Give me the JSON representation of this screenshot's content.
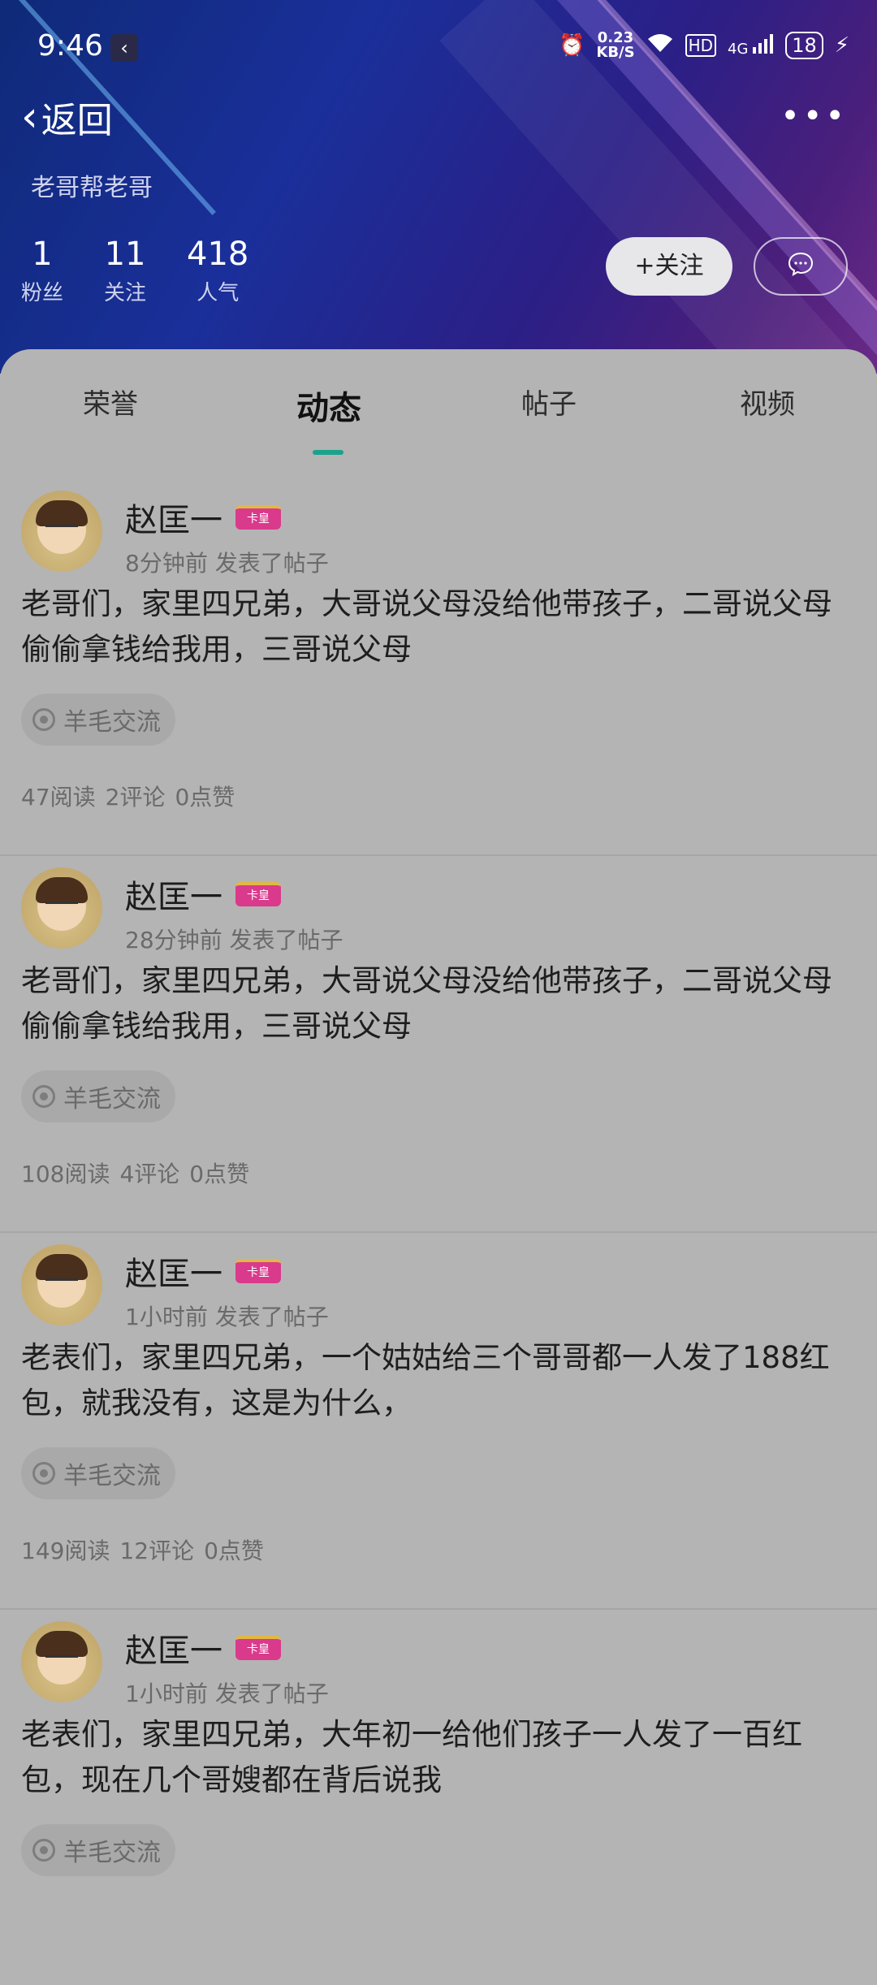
{
  "status_bar": {
    "time": "9:46",
    "speed_value": "0.23",
    "speed_unit": "KB/S",
    "hd": "HD",
    "network": "4G",
    "battery": "18"
  },
  "header": {
    "back_label": "返回",
    "nickname": "老哥帮老哥",
    "stats": [
      {
        "num": "1",
        "label": "粉丝"
      },
      {
        "num": "11",
        "label": "关注"
      },
      {
        "num": "418",
        "label": "人气"
      }
    ],
    "follow_label": "+关注"
  },
  "tabs": [
    {
      "label": "荣誉"
    },
    {
      "label": "动态"
    },
    {
      "label": "帖子"
    },
    {
      "label": "视频"
    }
  ],
  "active_tab": "动态",
  "posts": [
    {
      "author": "赵匡一",
      "badge": "卡皇",
      "meta": "8分钟前  发表了帖子",
      "content": "老哥们，家里四兄弟，大哥说父母没给他带孩子，二哥说父母偷偷拿钱给我用，三哥说父母",
      "topic": "羊毛交流",
      "reads": "47阅读",
      "comments": "2评论",
      "likes": "0点赞"
    },
    {
      "author": "赵匡一",
      "badge": "卡皇",
      "meta": "28分钟前  发表了帖子",
      "content": "老哥们，家里四兄弟，大哥说父母没给他带孩子，二哥说父母偷偷拿钱给我用，三哥说父母",
      "topic": "羊毛交流",
      "reads": "108阅读",
      "comments": "4评论",
      "likes": "0点赞"
    },
    {
      "author": "赵匡一",
      "badge": "卡皇",
      "meta": "1小时前  发表了帖子",
      "content": "老表们，家里四兄弟，一个姑姑给三个哥哥都一人发了188红包，就我没有，这是为什么，",
      "topic": "羊毛交流",
      "reads": "149阅读",
      "comments": "12评论",
      "likes": "0点赞"
    },
    {
      "author": "赵匡一",
      "badge": "卡皇",
      "meta": "1小时前  发表了帖子",
      "content": "老表们，家里四兄弟，大年初一给他们孩子一人发了一百红包，现在几个哥嫂都在背后说我",
      "topic": "羊毛交流",
      "reads": "",
      "comments": "",
      "likes": ""
    }
  ]
}
